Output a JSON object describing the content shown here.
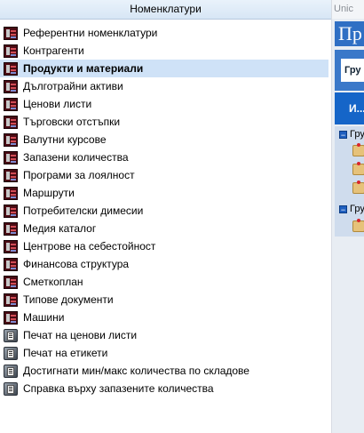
{
  "panel": {
    "title": "Номенклатури",
    "items": [
      {
        "label": "Референтни номенклатури",
        "icon": "nomenclature-book-icon"
      },
      {
        "label": "Контрагенти",
        "icon": "nomenclature-book-icon"
      },
      {
        "label": "Продукти и материали",
        "icon": "nomenclature-book-icon",
        "selected": true
      },
      {
        "label": "Дълготрайни активи",
        "icon": "nomenclature-book-icon"
      },
      {
        "label": "Ценови листи",
        "icon": "nomenclature-book-icon"
      },
      {
        "label": "Търговски отстъпки",
        "icon": "nomenclature-book-icon"
      },
      {
        "label": "Валутни курсове",
        "icon": "nomenclature-book-icon"
      },
      {
        "label": "Запазени количества",
        "icon": "nomenclature-book-icon"
      },
      {
        "label": "Програми за лоялност",
        "icon": "nomenclature-book-icon"
      },
      {
        "label": "Маршрути",
        "icon": "nomenclature-book-icon"
      },
      {
        "label": "Потребителски димесии",
        "icon": "nomenclature-book-icon"
      },
      {
        "label": "Медия каталог",
        "icon": "nomenclature-book-icon"
      },
      {
        "label": "Центрове на себестойност",
        "icon": "nomenclature-book-icon"
      },
      {
        "label": "Финансова структура",
        "icon": "nomenclature-book-icon"
      },
      {
        "label": "Сметкоплан",
        "icon": "nomenclature-book-icon"
      },
      {
        "label": "Типове документи",
        "icon": "nomenclature-book-icon"
      },
      {
        "label": "Машини",
        "icon": "nomenclature-book-icon"
      },
      {
        "label": "Печат на ценови листи",
        "icon": "report-icon"
      },
      {
        "label": "Печат на етикети",
        "icon": "report-icon"
      },
      {
        "label": "Достигнати мин/макс количества по складове",
        "icon": "report-icon"
      },
      {
        "label": "Справка върху запазените количества",
        "icon": "report-icon"
      }
    ]
  },
  "background_window": {
    "title": "Unic",
    "banner": "Пр",
    "button_label": "Гру",
    "column_header": "И...",
    "groups": [
      {
        "label": "Гру"
      },
      {
        "label": "Гру"
      }
    ]
  },
  "colors": {
    "selected_row": "#cfe2f7",
    "header_gradient_top": "#e9f2fb",
    "accent_blue": "#1565c8"
  }
}
